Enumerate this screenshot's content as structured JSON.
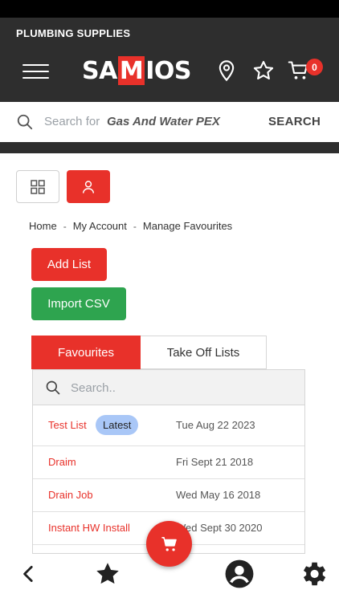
{
  "header": {
    "tagline": "PLUMBING SUPPLIES",
    "logo": {
      "left": "SA",
      "middle": "M",
      "right": "IOS"
    },
    "cart_count": "0",
    "icons": [
      "menu-icon",
      "location-pin-icon",
      "star-icon",
      "cart-icon"
    ]
  },
  "search": {
    "prefix": "Search for",
    "suggestion": "Gas And Water PEX",
    "button_label": "SEARCH"
  },
  "breadcrumb": [
    "Home",
    "My Account",
    "Manage Favourites"
  ],
  "breadcrumb_sep": "-",
  "actions": {
    "add_list": "Add List",
    "import_csv": "Import CSV"
  },
  "tabs": [
    {
      "label": "Favourites",
      "active": true
    },
    {
      "label": "Take Off Lists",
      "active": false
    }
  ],
  "list_search": {
    "placeholder": "Search.."
  },
  "lists": [
    {
      "name": "Test List",
      "badge": "Latest",
      "date": "Tue Aug 22 2023"
    },
    {
      "name": "Draim",
      "date": "Fri Sept 21 2018"
    },
    {
      "name": "Drain Job",
      "date": "Wed May 16 2018"
    },
    {
      "name": "Instant HW Install",
      "date": "Wed Sept 30 2020"
    }
  ],
  "colors": {
    "accent": "#e8312a",
    "success": "#2ea44f",
    "dark": "#2e2e2e",
    "badge": "#a9c7f7"
  },
  "bottom_nav": [
    "back-icon",
    "favourites-star-icon",
    "account-icon",
    "settings-gear-icon"
  ]
}
